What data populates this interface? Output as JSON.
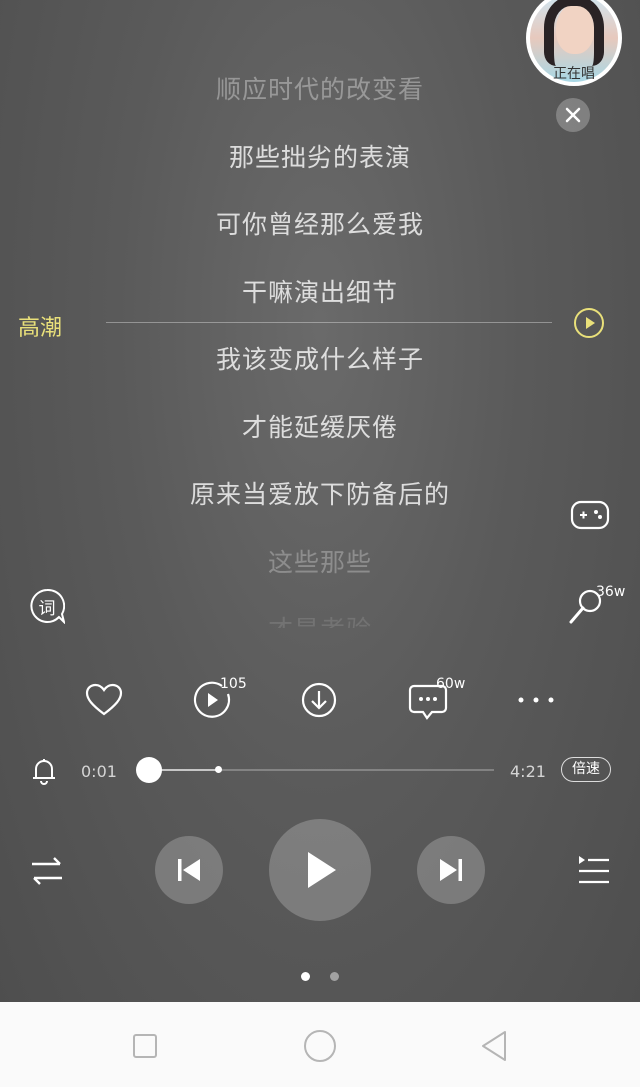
{
  "singing_widget": {
    "label": "正在唱"
  },
  "lyrics": [
    "顺应时代的改变看",
    "那些拙劣的表演",
    "可你曾经那么爱我",
    "干嘛演出细节",
    "我该变成什么样子",
    "才能延缓厌倦",
    "原来当爱放下防备后的",
    "这些那些",
    "才是考验"
  ],
  "climax": {
    "label": "高潮"
  },
  "lyric_button": {
    "label": "词"
  },
  "sing_count": "36w",
  "actions": {
    "share_count": "105",
    "comment_count": "60w"
  },
  "player": {
    "current_time": "0:01",
    "total_time": "4:21",
    "progress": 0.0038,
    "speed_label": "倍速"
  },
  "pager": {
    "pages": 2,
    "current": 1
  },
  "colors": {
    "accent": "#e9e07a",
    "background": "#5a5a5a",
    "nav_bg": "#fafafa"
  }
}
